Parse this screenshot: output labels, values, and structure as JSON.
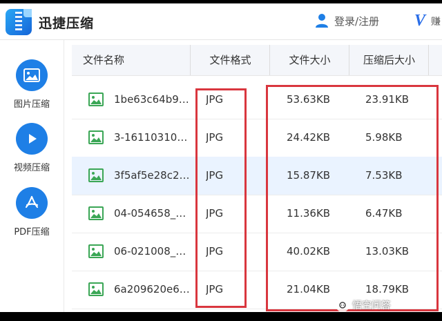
{
  "app": {
    "title": "迅捷压缩"
  },
  "header": {
    "login_label": "登录/注册",
    "vip_partial": "赚"
  },
  "sidebar": {
    "items": [
      {
        "label": "图片压缩",
        "icon": "image-icon"
      },
      {
        "label": "视频压缩",
        "icon": "play-icon"
      },
      {
        "label": "PDF压缩",
        "icon": "pdf-icon"
      }
    ]
  },
  "table": {
    "columns": [
      "文件名称",
      "文件格式",
      "文件大小",
      "压缩后大小"
    ],
    "rows": [
      {
        "name": "1be63c64b9d...",
        "format": "JPG",
        "size": "53.63KB",
        "compressed": "23.91KB"
      },
      {
        "name": "3-161103102...",
        "format": "JPG",
        "size": "24.42KB",
        "compressed": "5.98KB"
      },
      {
        "name": "3f5af5e28c24...",
        "format": "JPG",
        "size": "15.87KB",
        "compressed": "7.53KB"
      },
      {
        "name": "04-054658_1...",
        "format": "JPG",
        "size": "11.36KB",
        "compressed": "6.47KB"
      },
      {
        "name": "06-021008_7...",
        "format": "JPG",
        "size": "40.02KB",
        "compressed": "13.03KB"
      },
      {
        "name": "6a209620e6f...",
        "format": "JPG",
        "size": "21.04KB",
        "compressed": "18.79KB"
      }
    ]
  },
  "watermark": {
    "text": "悟空问答"
  },
  "colors": {
    "accent": "#1e7fe6",
    "highlight": "#d9363e",
    "thumb": "#3aa655",
    "selected_row": "#eaf3ff"
  }
}
